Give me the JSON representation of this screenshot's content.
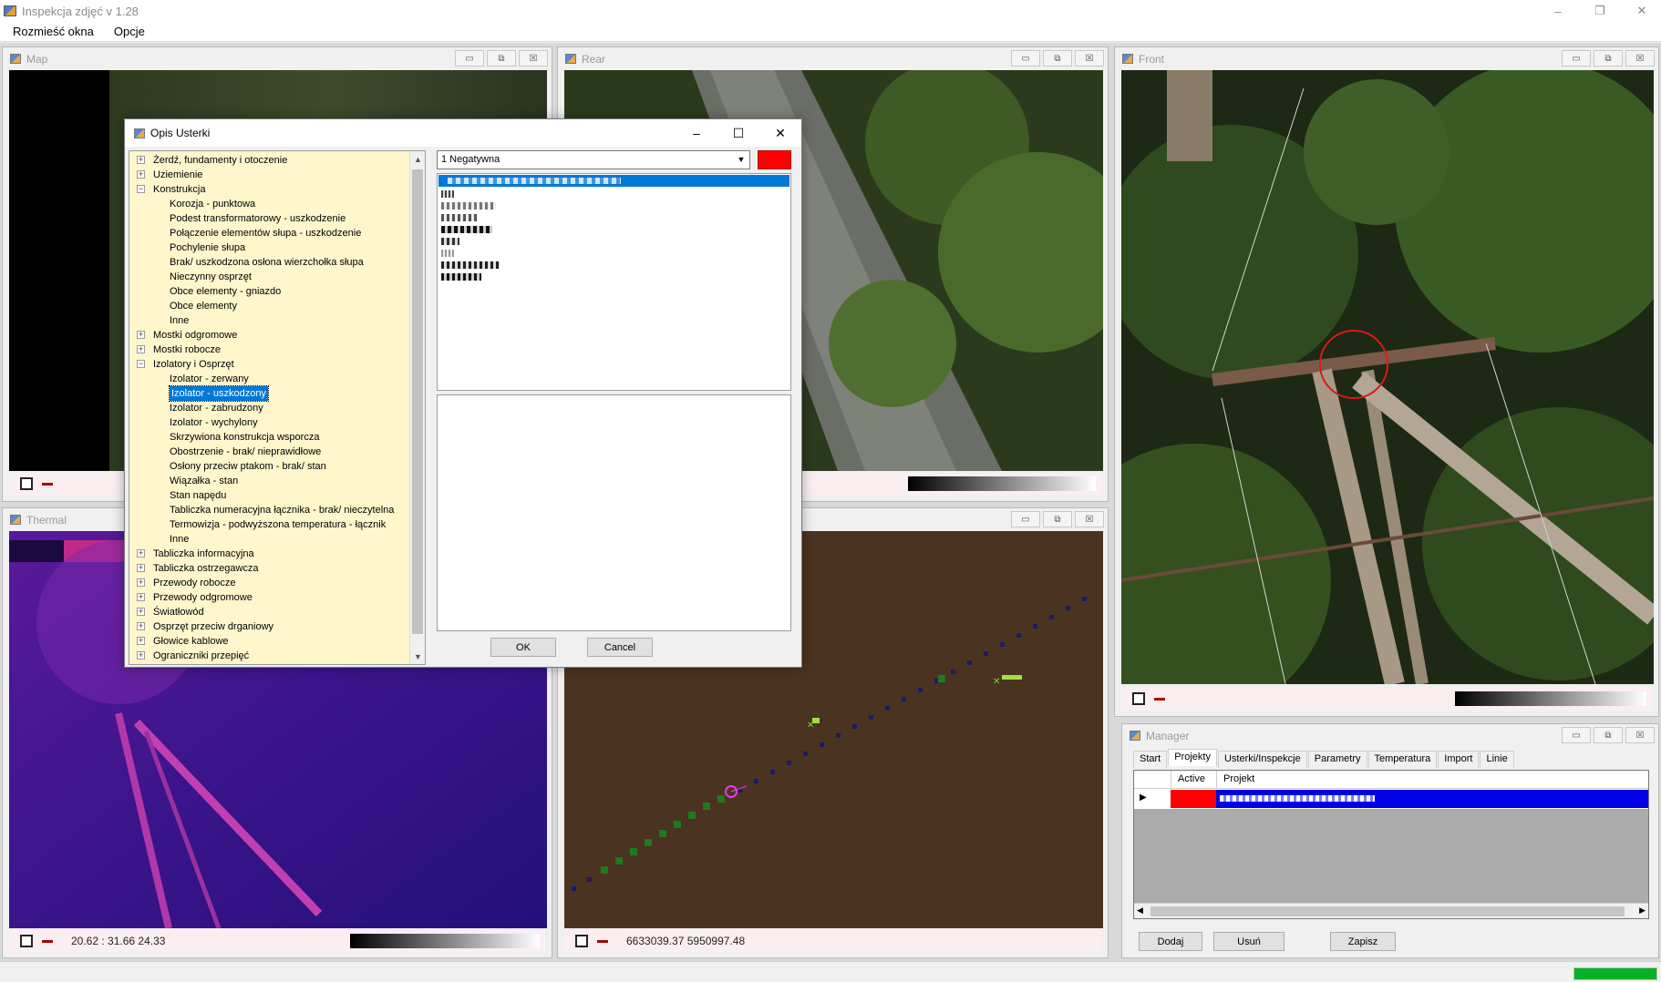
{
  "app": {
    "title": "Inspekcja zdjęć v 1.28"
  },
  "window_controls": {
    "minimize": "–",
    "restore": "❐",
    "close": "✕"
  },
  "menu": [
    "Rozmieść okna",
    "Opcje"
  ],
  "child_buttons": {
    "min": "▭",
    "max": "⧉",
    "close": "☒"
  },
  "windows": {
    "map": {
      "title": "Map"
    },
    "rear": {
      "title": "Rear"
    },
    "front": {
      "title": "Front"
    },
    "thermal": {
      "title": "Thermal",
      "readout": "20.62 : 31.66   24.33"
    },
    "track": {
      "readout": "6633039.37 5950997.48"
    },
    "manager": {
      "title": "Manager",
      "tabs": [
        "Start",
        "Projekty",
        "Usterki/Inspekcje",
        "Parametry",
        "Temperatura",
        "Import",
        "Linie"
      ],
      "active_tab": "Projekty",
      "grid_headers": [
        "Active",
        "Projekt"
      ],
      "buttons": {
        "add": "Dodaj",
        "remove": "Usuń",
        "save": "Zapisz"
      }
    }
  },
  "dialog": {
    "title": "Opis Usterki",
    "controls": {
      "minimize": "–",
      "maximize": "☐",
      "close": "✕"
    },
    "combo_value": "1 Negatywna",
    "severity_color": "#ff0000",
    "ok": "OK",
    "cancel": "Cancel",
    "tree": [
      {
        "label": "Żerdź, fundamenty i otoczenie",
        "level": 0,
        "toggle": "+"
      },
      {
        "label": "Uziemienie",
        "level": 0,
        "toggle": "+"
      },
      {
        "label": "Konstrukcja",
        "level": 0,
        "toggle": "−"
      },
      {
        "label": "Korozja - punktowa",
        "level": 1
      },
      {
        "label": "Podest transformatorowy - uszkodzenie",
        "level": 1
      },
      {
        "label": "Połączenie elementów słupa - uszkodzenie",
        "level": 1
      },
      {
        "label": "Pochylenie słupa",
        "level": 1
      },
      {
        "label": "Brak/ uszkodzona osłona wierzchołka słupa",
        "level": 1
      },
      {
        "label": "Nieczynny osprzęt",
        "level": 1
      },
      {
        "label": "Obce elementy - gniazdo",
        "level": 1
      },
      {
        "label": "Obce elementy",
        "level": 1
      },
      {
        "label": "Inne",
        "level": 1
      },
      {
        "label": "Mostki odgromowe",
        "level": 0,
        "toggle": "+"
      },
      {
        "label": "Mostki robocze",
        "level": 0,
        "toggle": "+"
      },
      {
        "label": "Izolatory i Osprzęt",
        "level": 0,
        "toggle": "−"
      },
      {
        "label": "Izolator - zerwany",
        "level": 1
      },
      {
        "label": "Izolator - uszkodzony",
        "level": 1,
        "selected": true
      },
      {
        "label": "Izolator - zabrudzony",
        "level": 1
      },
      {
        "label": "Izolator - wychylony",
        "level": 1
      },
      {
        "label": "Skrzywiona konstrukcja wsporcza",
        "level": 1
      },
      {
        "label": "Obostrzenie - brak/ nieprawidłowe",
        "level": 1
      },
      {
        "label": "Osłony przeciw ptakom - brak/ stan",
        "level": 1
      },
      {
        "label": "Wiązałka - stan",
        "level": 1
      },
      {
        "label": "Stan napędu",
        "level": 1
      },
      {
        "label": "Tabliczka numeracyjna łącznika - brak/ nieczytelna",
        "level": 1
      },
      {
        "label": "Termowizja - podwyższona temperatura - łącznik",
        "level": 1
      },
      {
        "label": "Inne",
        "level": 1
      },
      {
        "label": "Tabliczka informacyjna",
        "level": 0,
        "toggle": "+"
      },
      {
        "label": "Tabliczka ostrzegawcza",
        "level": 0,
        "toggle": "+"
      },
      {
        "label": "Przewody robocze",
        "level": 0,
        "toggle": "+"
      },
      {
        "label": "Przewody odgromowe",
        "level": 0,
        "toggle": "+"
      },
      {
        "label": "Światłowód",
        "level": 0,
        "toggle": "+"
      },
      {
        "label": "Osprzęt przeciw drganiowy",
        "level": 0,
        "toggle": "+"
      },
      {
        "label": "Głowice kablowe",
        "level": 0,
        "toggle": "+"
      },
      {
        "label": "Ograniczniki przepięć",
        "level": 0,
        "toggle": "+"
      }
    ]
  }
}
